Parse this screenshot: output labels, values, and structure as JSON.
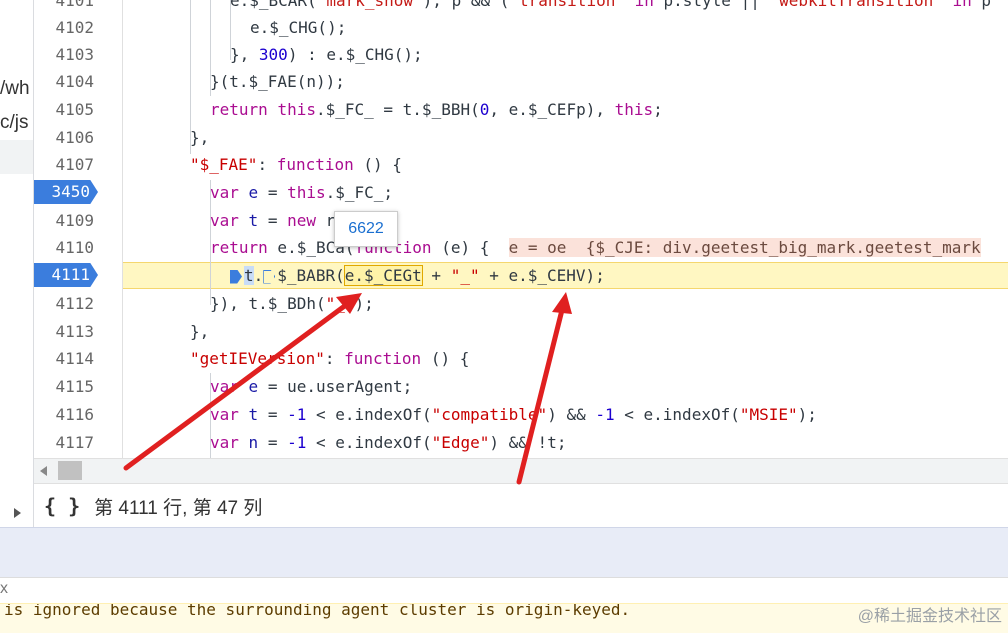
{
  "left_pane": {
    "frag1": "/wh",
    "frag2": "c/js"
  },
  "editor": {
    "lines": [
      {
        "n": "4101"
      },
      {
        "n": "4102"
      },
      {
        "n": "4103"
      },
      {
        "n": "4104"
      },
      {
        "n": "4105"
      },
      {
        "n": "4106"
      },
      {
        "n": "4107"
      },
      {
        "n": "3450"
      },
      {
        "n": "4109"
      },
      {
        "n": "4110"
      },
      {
        "n": "4111"
      },
      {
        "n": "4112"
      },
      {
        "n": "4113"
      },
      {
        "n": "4114"
      },
      {
        "n": "4115"
      },
      {
        "n": "4116"
      },
      {
        "n": "4117"
      }
    ],
    "breakpoint_labels": [
      "3450",
      "4111"
    ],
    "tooltip_value": "6622",
    "inline_value": "e = oe  {$_CJE: div.geetest_big_mark.geetest_mark"
  },
  "status_bar": {
    "braces_icon": "{ }",
    "position_text": "第 4111 行, 第 47 列"
  },
  "console": {
    "left_text": "x",
    "warning_text": "is ignored because the surrounding agent cluster is origin-keyed."
  },
  "watermark": "@稀土掘金技术社区",
  "colors": {
    "breakpoint": "#3b7ddd",
    "annotation_arrow": "#e02020",
    "current_line": "#fff7c2"
  }
}
